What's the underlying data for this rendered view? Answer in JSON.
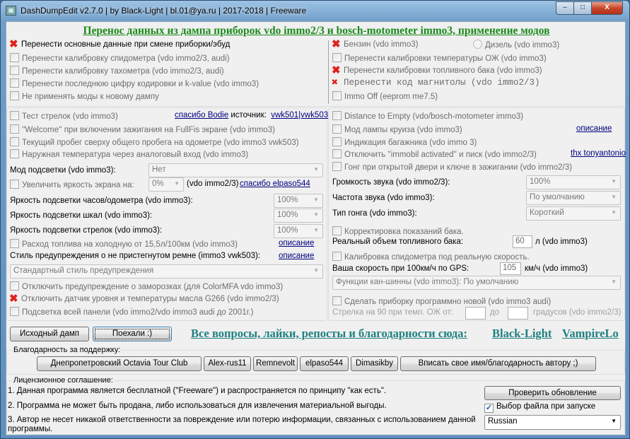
{
  "window": {
    "title": "DashDumpEdit v2.7.0 | by Black-Light | bl.01@ya.ru | 2017-2018 | Freeware",
    "minimize": "–",
    "maximize": "□",
    "close": "X"
  },
  "header": "Перенос данных из дампа приборок vdo immo2/3 и bosch-motometer immo3, применение модов",
  "transfer_left": [
    {
      "label": "Перенести основные данные при смене приборки/эбуд",
      "checked": true
    },
    {
      "label": "Перенести калибровку спидометра (vdo immo2/3, audi)",
      "checked": false
    },
    {
      "label": "Перенести калибровку тахометра (vdo immo2/3, audi)",
      "checked": false
    },
    {
      "label": "Перенести последнюю цифру кодировки и k-value (vdo immo3)",
      "checked": false
    },
    {
      "label": "Не применять моды к новому дампу",
      "checked": false
    }
  ],
  "transfer_right": {
    "petrol": "Бензин (vdo immo3)",
    "diesel": "Дизель (vdo immo3)",
    "items": [
      {
        "label": "Перенести калибровки температуры ОЖ (vdo immo3)",
        "checked": false
      },
      {
        "label": "Перенести калибровки топливного бака (vdo immo3)",
        "checked": true
      },
      {
        "label": "Перенести код магнитолы (vdo immo2/3)",
        "checked": true
      },
      {
        "label": "Immo Off (eeprom me7.5)",
        "checked": false
      }
    ]
  },
  "mods_left": {
    "needle_test": "Тест стрелок (vdo immo3)",
    "thanks_bodie": "спасибо Bodie",
    "source_label": "источник:",
    "source_link": "vwk501|vwk503",
    "welcome": "''Welcome'' при включении зажигания на FullFis экране (vdo immo3)",
    "trip": "Текущий пробег сверху общего пробега на одометре (vdo immo3 vwk503)",
    "outside_temp": "Наружная температура через аналоговый вход (vdo immo3)",
    "backlight_mode_label": "Мод подсветки (vdo immo3):",
    "backlight_mode_value": "Нет",
    "brightness": "Увеличить яркость экрана на:",
    "brightness_value": "0%",
    "brightness_note": "(vdo immo2/3)",
    "thanks_elpaso": "спасибо elpaso544",
    "clock_bl_label": "Яркость подсветки часов/одометра (vdo immo3):",
    "clock_bl_value": "100%",
    "scale_bl_label": "Яркость подсветки шкал (vdo immo3):",
    "scale_bl_value": "100%",
    "needle_bl_label": "Яркость подсветки стрелок (vdo immo3):",
    "needle_bl_value": "100%",
    "cold_fuel": "Расход топлива на холодную от 15,5л/100км (vdo immo3)",
    "description": "описание",
    "belt_label": "Стиль предупреждения о не пристегнутом ремне (immo3 vwk503):",
    "belt_value": "Стандартный стиль предупреждения",
    "frost": "Отключить предупреждение о заморозках (для ColorMFA vdo immo3)",
    "oil_sensor": "Отключить датчик уровня и температуры масла G266 (vdo immo2/3)",
    "full_bl": "Подсветка всей панели (vdo immo2/vdo immo3 audi до 2001г.)"
  },
  "mods_right": {
    "dte": "Distance to Empty (vdo/bosch-motometer immo3)",
    "cruise": "Мод лампы круиза (vdo immo3)",
    "description": "описание",
    "trunk": "Индикация багажника (vdo immo 3)",
    "immobil": "Отключить ''immobil activated'' и писк (vdo immo2/3)",
    "thx_tony": "thx tonyantonio",
    "gong_door": "Гонг при открытой двери и ключе в зажигании (vdo immo2/3)",
    "volume_label": "Громкость звука (vdo immo2/3):",
    "volume_value": "100%",
    "freq_label": "Частота звука (vdo immo3):",
    "freq_value": "По умолчанию",
    "gong_type_label": "Тип гонга (vdo immo3):",
    "gong_type_value": "Короткий",
    "tank_corr": "Корректировка показаний бака.",
    "tank_volume_label": "Реальный объем топливного бака:",
    "tank_volume_value": "60",
    "tank_unit": "л (vdo immo3)",
    "speedo_cal": "Калибровка спидометра под реальную скорость.",
    "gps_label": "Ваша скорость при 100км/ч по GPS:",
    "gps_value": "105",
    "gps_unit": "км/ч (vdo immo3)",
    "can_value": "Функции кан-шинны (vdo immo3): По умолчанию",
    "new_cluster": "Сделать приборку программно новой (vdo immo3 audi)",
    "needle90_label": "Стрелка на 90 при темп. ОЖ от:",
    "needle90_to": "до",
    "needle90_unit": "градусов (vdo immo2/3)"
  },
  "actions": {
    "original_dump": "Исходный дамп",
    "go": "Поехали :)",
    "feedback": "Все вопросы, лайки, репосты и благодарности сюда:",
    "author1": "Black-Light",
    "author2": "VampireLo"
  },
  "thanks": {
    "title": "Благодарность за поддержку:",
    "buttons": [
      "Днепропетровский Octavia Tour Club",
      "Alex-rus11",
      "Remnevolt",
      "elpaso544",
      "Dimasikby",
      "Вписать свое имя/благодарность автору ;)"
    ]
  },
  "license": {
    "title": "Лицензионное соглашение:",
    "lines": [
      "1. Данная программа является бесплатной (\"Freeware\") и распространяется по принципу \"как есть\".",
      "2. Программа не может быть продана, либо использоваться для извлечения материальной выгоды.",
      "3. Автор не несет никакой ответственности за повреждение или потерю информации, связанных с использованием данной",
      "программы."
    ],
    "check_update": "Проверить обновление",
    "choose_file": "Выбор файла при запуске",
    "choose_file_checked": true,
    "language": "Russian"
  }
}
